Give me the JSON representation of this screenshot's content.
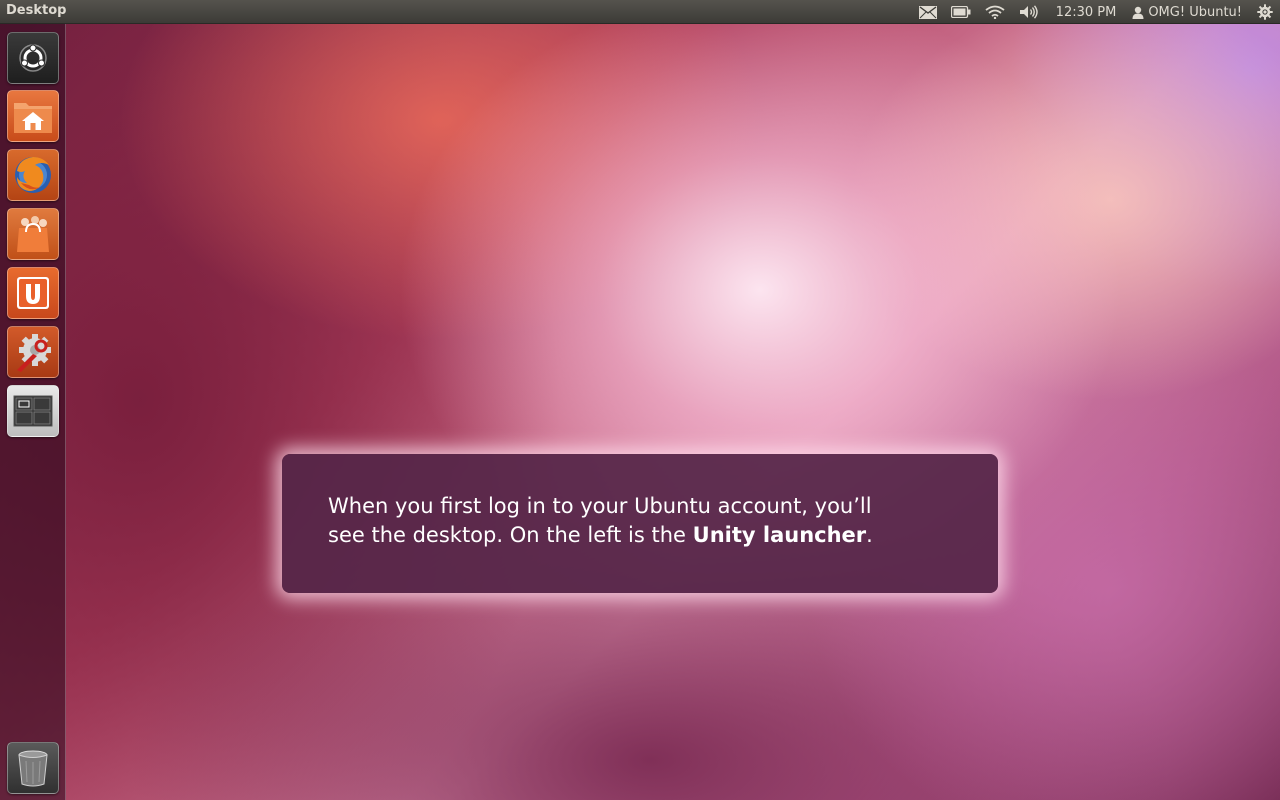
{
  "panel": {
    "title": "Desktop",
    "clock": "12:30 PM",
    "user_name": "OMG! Ubuntu!"
  },
  "indicators": [
    "mail-icon",
    "battery-icon",
    "wifi-icon",
    "volume-icon",
    "user-icon",
    "power-gear-icon"
  ],
  "launcher": {
    "items": [
      {
        "name": "dash-home",
        "icon": "ubuntu-logo-icon"
      },
      {
        "name": "home-folder",
        "icon": "home-folder-icon"
      },
      {
        "name": "firefox",
        "icon": "firefox-icon"
      },
      {
        "name": "software-center",
        "icon": "shopping-bag-icon"
      },
      {
        "name": "ubuntu-one",
        "icon": "ubuntu-one-icon"
      },
      {
        "name": "system-settings",
        "icon": "settings-wrench-icon"
      },
      {
        "name": "workspace-switcher",
        "icon": "workspace-switcher-icon"
      },
      {
        "name": "trash",
        "icon": "trash-icon"
      }
    ]
  },
  "dialog": {
    "text_part1": "When you first log in to your Ubuntu account, you’ll see the desktop. On the left is the ",
    "text_bold": "Unity launcher",
    "text_part2": "."
  },
  "colors": {
    "panel": "#3c3b37",
    "accent_orange": "#dd4814",
    "dialog_bg": "#552648"
  }
}
